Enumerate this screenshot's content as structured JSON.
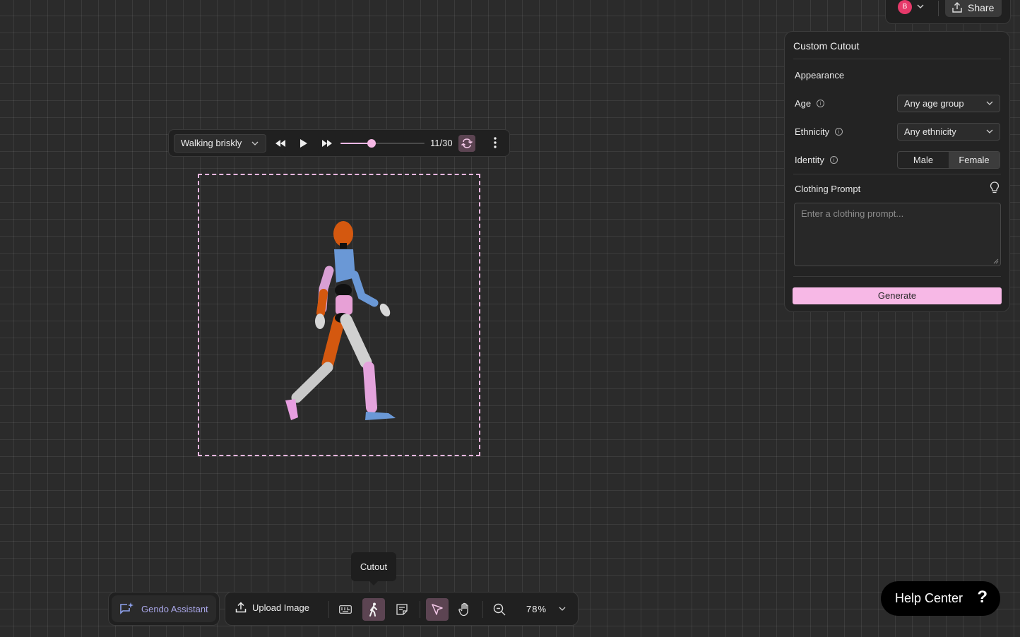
{
  "header": {
    "avatar_initial": "B",
    "share_label": "Share"
  },
  "panel": {
    "title": "Custom Cutout",
    "appearance_title": "Appearance",
    "age": {
      "label": "Age",
      "value": "Any age group"
    },
    "ethnicity": {
      "label": "Ethnicity",
      "value": "Any ethnicity"
    },
    "identity": {
      "label": "Identity",
      "options": [
        "Male",
        "Female"
      ],
      "selected": "Female"
    },
    "clothing_prompt": {
      "label": "Clothing Prompt",
      "placeholder": "Enter a clothing prompt..."
    },
    "generate_label": "Generate"
  },
  "animation": {
    "selected": "Walking briskly",
    "frame_label": "11/30",
    "current_frame": 11,
    "total_frames": 30
  },
  "bottom": {
    "assistant_label": "Gendo Assistant",
    "upload_label": "Upload Image",
    "zoom": "78%",
    "tooltip": "Cutout"
  },
  "help": {
    "label": "Help Center",
    "icon": "?"
  },
  "icons": [
    "chevron-down-icon",
    "share-icon",
    "info-icon",
    "lightbulb-icon",
    "rewind-icon",
    "play-icon",
    "fast-forward-icon",
    "loop-icon",
    "more-vertical-icon",
    "sparkle-chat-icon",
    "upload-icon",
    "keyboard-icon",
    "person-walking-icon",
    "note-icon",
    "select-pointer-icon",
    "hand-icon",
    "zoom-icon"
  ],
  "colors": {
    "accent": "#f7b8e6",
    "assistant": "#a9a6e8",
    "avatar": "#e6396a"
  }
}
